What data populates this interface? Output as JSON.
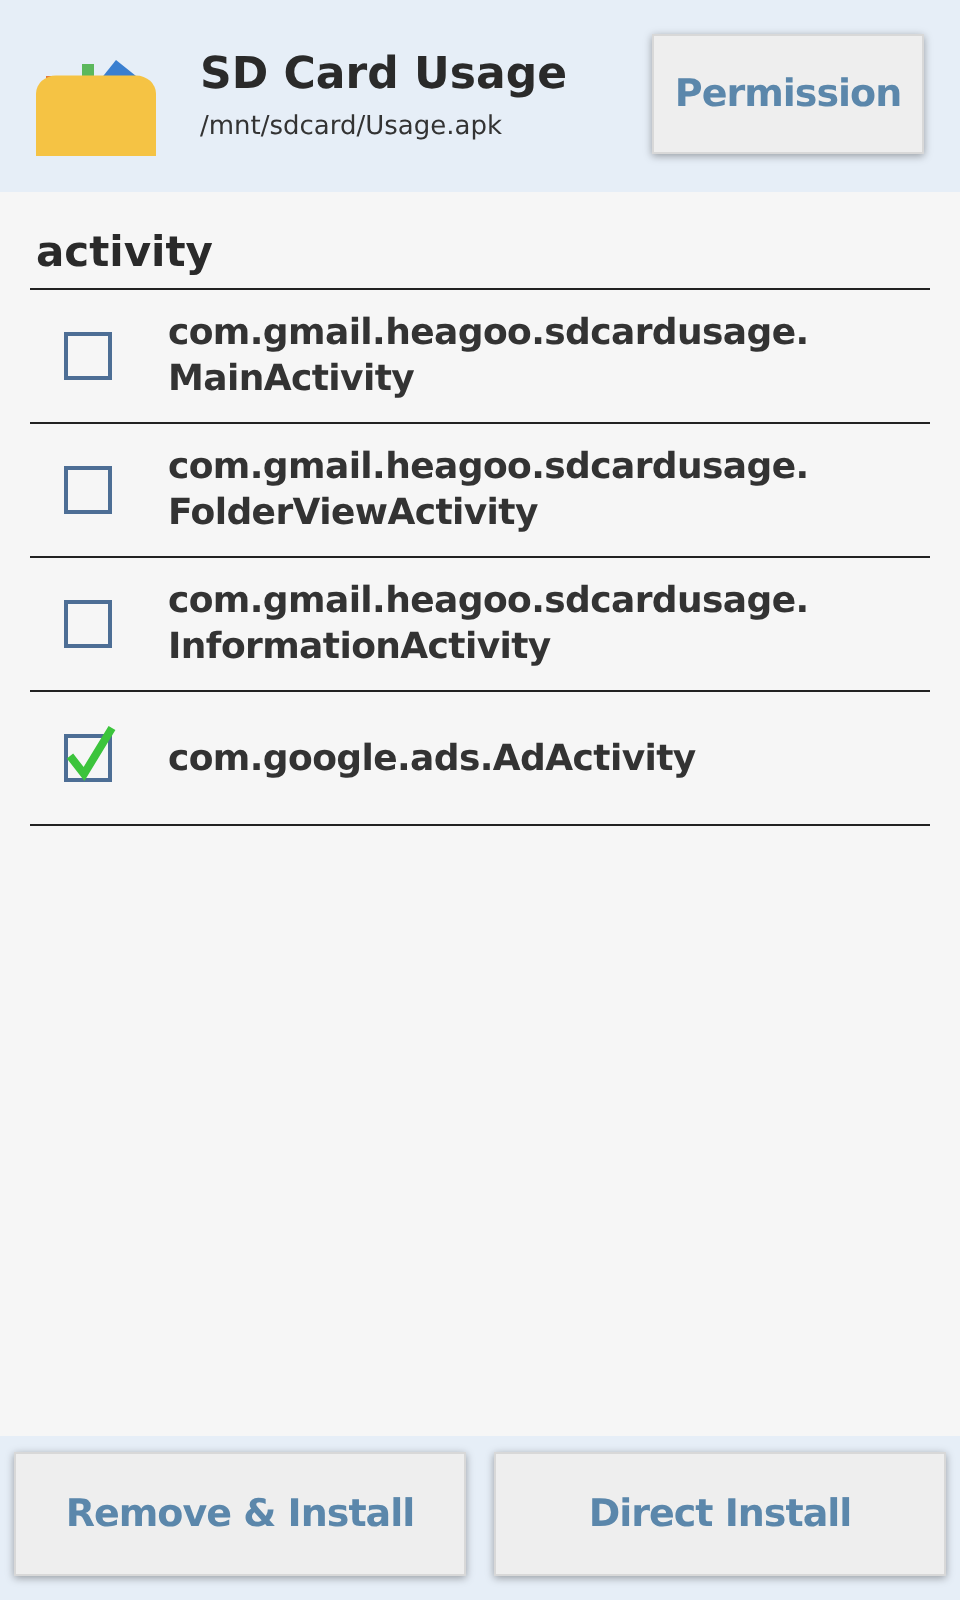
{
  "header": {
    "title": "SD Card Usage",
    "path": "/mnt/sdcard/Usage.apk",
    "button": "Permission"
  },
  "section": {
    "title": "activity"
  },
  "activities": [
    {
      "name": "com.gmail.heagoo.sdcardusage.\nMainActivity",
      "checked": false
    },
    {
      "name": "com.gmail.heagoo.sdcardusage.\nFolderViewActivity",
      "checked": false
    },
    {
      "name": "com.gmail.heagoo.sdcardusage.\nInformationActivity",
      "checked": false
    },
    {
      "name": "com.google.ads.AdActivity",
      "checked": true
    }
  ],
  "buttons": [
    "Remove & Install",
    "Direct Install"
  ]
}
